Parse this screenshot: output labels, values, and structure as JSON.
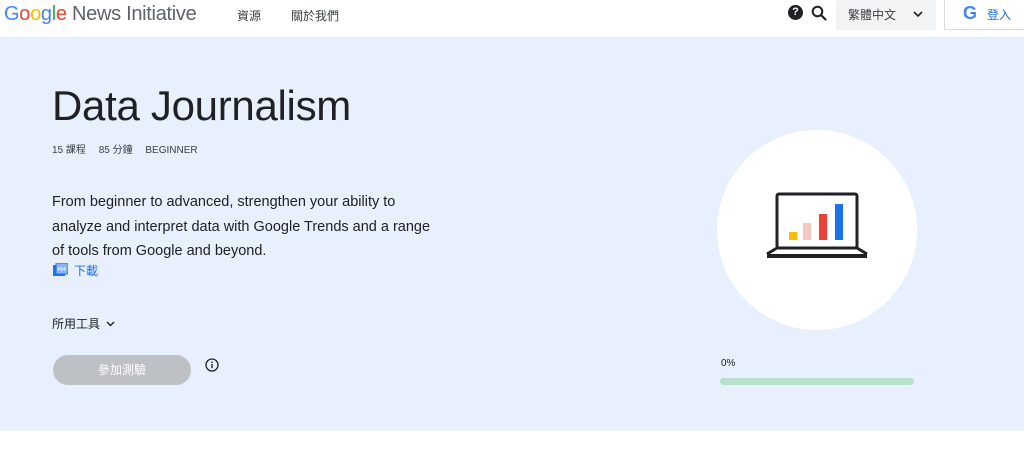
{
  "header": {
    "logo_brand": "Google",
    "logo_rest": "News Initiative",
    "nav": [
      "資源",
      "關於我們"
    ],
    "help_icon": "question-circle-icon",
    "search_icon": "search-icon",
    "language": "繁體中文",
    "signin_label": "登入"
  },
  "course": {
    "title": "Data Journalism",
    "lessons": "15 課程",
    "duration": "85 分鐘",
    "level": "BEGINNER",
    "description": "From beginner to advanced, strengthen your ability to analyze and interpret data with Google Trends and a range of tools from Google and beyond.",
    "download_label": "下載",
    "tools_label": "所用工具",
    "quiz_button": "參加測驗",
    "progress_label": "0%",
    "progress_value": 0
  },
  "colors": {
    "hero_bg": "#e8f0fe",
    "link": "#1a73e8",
    "progress_track": "#b7e1cd",
    "button_disabled": "#bdc1c6"
  }
}
